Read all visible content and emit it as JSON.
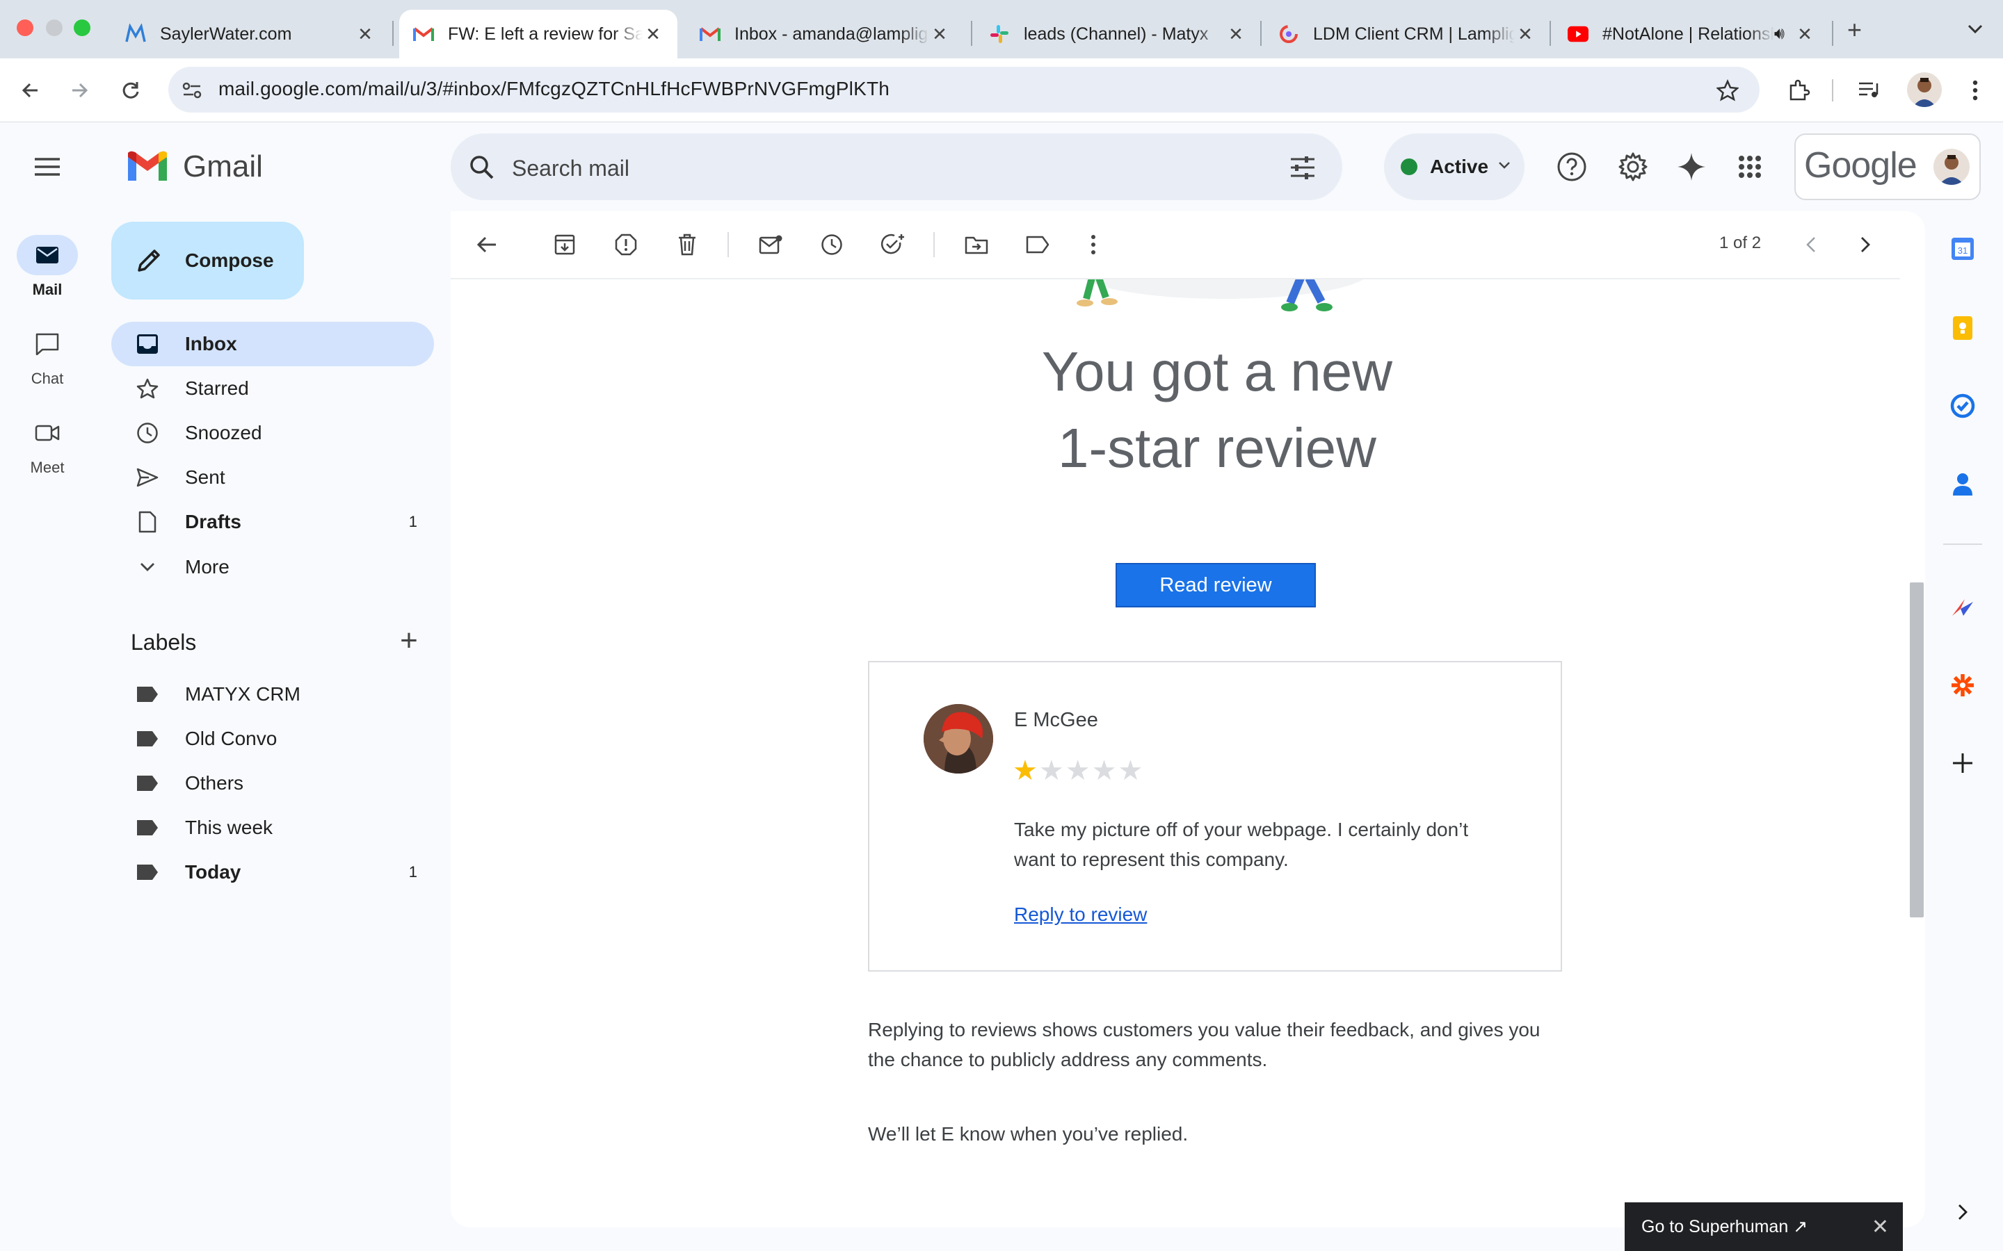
{
  "browser": {
    "tabs": [
      {
        "title": "SaylerWater.com",
        "favicon": "sayler-m-icon"
      },
      {
        "title": "FW: E left a review for Sayler",
        "favicon": "gmail-icon",
        "active": true
      },
      {
        "title": "Inbox - amanda@lamplighter",
        "favicon": "gmail-icon"
      },
      {
        "title": "leads (Channel) - Matyx",
        "favicon": "slack-icon"
      },
      {
        "title": "LDM Client CRM | Lamplighter",
        "favicon": "crm-icon"
      },
      {
        "title": "#NotAlone | Relationship",
        "favicon": "youtube-icon"
      }
    ],
    "url": "mail.google.com/mail/u/3/#inbox/FMfcgzQZTCnHLfHcFWBPrNVGFmgPlKTh"
  },
  "gmail": {
    "product_name": "Gmail",
    "rail": [
      {
        "label": "Mail"
      },
      {
        "label": "Chat"
      },
      {
        "label": "Meet"
      }
    ],
    "search_placeholder": "Search mail",
    "status": "Active",
    "account_brand": "Google",
    "compose_label": "Compose",
    "nav": [
      {
        "label": "Inbox",
        "icon": "inbox-icon",
        "selected": true
      },
      {
        "label": "Starred",
        "icon": "star-icon"
      },
      {
        "label": "Snoozed",
        "icon": "clock-icon"
      },
      {
        "label": "Sent",
        "icon": "send-icon"
      },
      {
        "label": "Drafts",
        "icon": "draft-icon",
        "count": "1",
        "bold": true
      },
      {
        "label": "More",
        "icon": "chevron-down-icon"
      }
    ],
    "labels_title": "Labels",
    "labels": [
      {
        "label": "MATYX CRM"
      },
      {
        "label": "Old Convo"
      },
      {
        "label": "Others"
      },
      {
        "label": "This week"
      },
      {
        "label": "Today",
        "count": "1",
        "bold": true
      }
    ],
    "pager": "1 of 2"
  },
  "email": {
    "headline_line1": "You got a new",
    "headline_line2": "1-star review",
    "read_button": "Read review",
    "reviewer_name": "E McGee",
    "rating": 1,
    "rating_max": 5,
    "review_text": "Take my picture off of your webpage. I certainly don’t want to represent this company.",
    "reply_link": "Reply to review",
    "paragraph_1": "Replying to reviews shows customers you value their feedback, and gives you the chance to publicly address any comments.",
    "paragraph_2": "We’ll let E know when you’ve replied."
  },
  "toast": {
    "text": "Go to Superhuman ↗"
  },
  "colors": {
    "accent_blue": "#1a73e8",
    "selected_nav": "#d3e3fd",
    "compose_bg": "#c2e7ff",
    "star_filled": "#fbbc04",
    "status_green": "#1e8e3e"
  }
}
